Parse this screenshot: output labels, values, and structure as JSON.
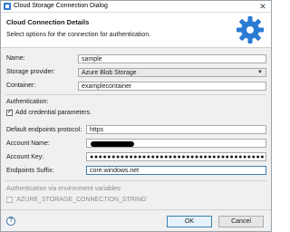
{
  "window": {
    "title": "Cloud Storage Connection Dialog"
  },
  "header": {
    "title": "Cloud Connection Details",
    "subtitle": "Select options for the connection for authentication."
  },
  "form": {
    "name_label": "Name:",
    "name_value": "sample",
    "provider_label": "Storage provider:",
    "provider_value": "Azure Blob Storage",
    "container_label": "Container:",
    "container_value": "examplecontainer",
    "auth_section_label": "Authentication:",
    "add_credentials_label": "Add credential parameters.",
    "add_credentials_checked": true,
    "protocol_label": "Default endpoints protocol:",
    "protocol_value": "https",
    "account_name_label": "Account Name:",
    "account_key_label": "Account Key:",
    "account_key_value": "●●●●●●●●●●●●●●●●●●●●●●●●●●●●●●●●●●●●●●●●●●●●●●●●●●●●●●",
    "endpoints_suffix_label": "Endpoints Suffix:",
    "endpoints_suffix_value": "core.windows.net",
    "env_section_label": "Authentication via environment variables:",
    "env_var_label": "'AZURE_STORAGE_CONNECTION_STRING'",
    "env_var_checked": false
  },
  "buttons": {
    "ok": "OK",
    "cancel": "Cancel",
    "help": "?"
  },
  "colors": {
    "accent": "#3c7fb1",
    "gear": "#2a7bd1"
  },
  "icons": [
    "app-icon",
    "close-icon",
    "gear-icon",
    "help-icon",
    "chevron-down-icon",
    "checkmark-icon"
  ]
}
